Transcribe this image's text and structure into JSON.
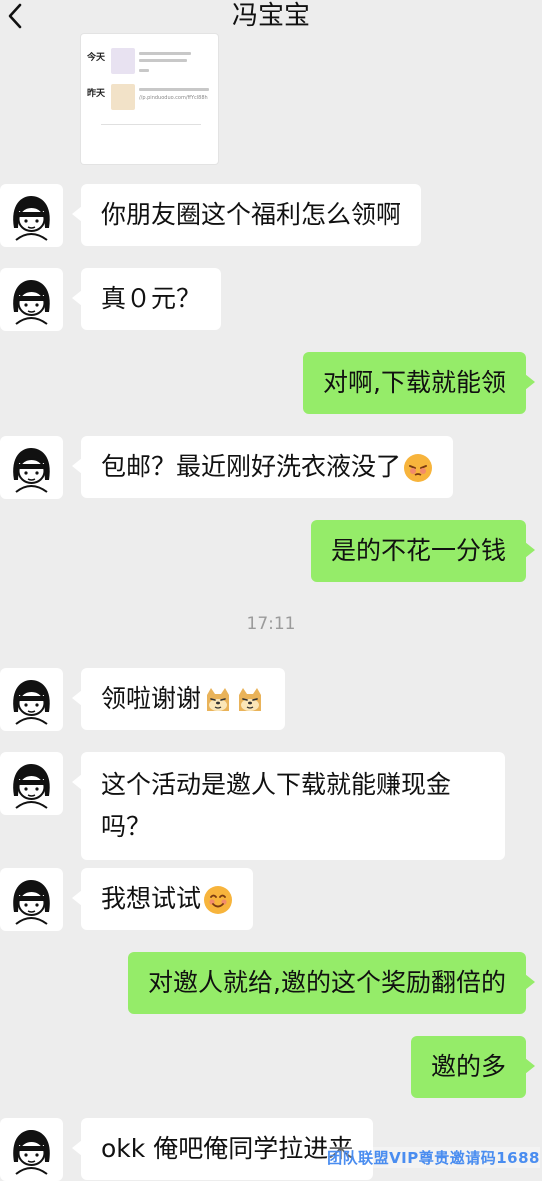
{
  "header": {
    "title": "冯宝宝"
  },
  "thumbnail": {
    "today_label": "今天",
    "yesterday_label": "昨天",
    "link_text": "//p.pinduoduo.com/ffYcl88h"
  },
  "timestamp": "17:11",
  "messages": [
    {
      "side": "in",
      "text": "你朋友圈这个福利怎么领啊"
    },
    {
      "side": "in",
      "text": "真０元？"
    },
    {
      "side": "out",
      "text": "对啊,下载就能领"
    },
    {
      "side": "in",
      "text": "包邮？最近刚好洗衣液没了"
    },
    {
      "side": "out",
      "text": "是的不花一分钱"
    },
    {
      "side": "in",
      "text": "领啦谢谢"
    },
    {
      "side": "in",
      "text": "这个活动是邀人下载就能赚现金吗？"
    },
    {
      "side": "in",
      "text": "我想试试"
    },
    {
      "side": "out",
      "text": "对邀人就给,邀的这个奖励翻倍的"
    },
    {
      "side": "out",
      "text": "邀的多"
    },
    {
      "side": "in",
      "text": "okk 俺吧俺同学拉进来"
    }
  ],
  "watermark": "团队联盟VIP尊贵邀请码1688",
  "colors": {
    "background": "#ededed",
    "incoming_bubble": "#ffffff",
    "outgoing_bubble": "#95ec69"
  }
}
